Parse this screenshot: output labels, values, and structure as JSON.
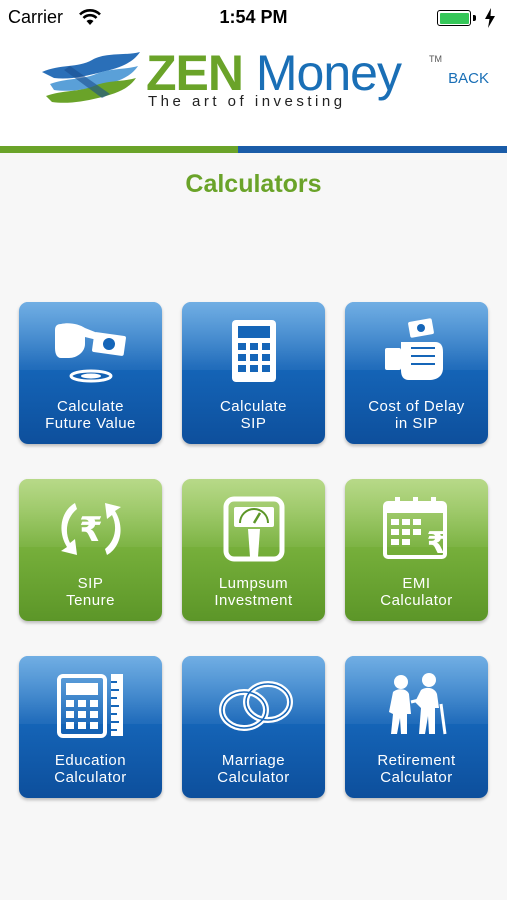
{
  "status_bar": {
    "carrier": "Carrier",
    "time": "1:54 PM"
  },
  "header": {
    "brand_zen": "ZEN",
    "brand_money": "Money",
    "tm": "TM",
    "tagline": "The art of investing",
    "back_label": "BACK",
    "colors": {
      "green": "#6aa329",
      "blue": "#1a6fb6"
    }
  },
  "page_title": "Calculators",
  "tiles": [
    {
      "line1": "Calculate",
      "line2": "Future Value",
      "color": "blue",
      "icon": "hand-money-icon"
    },
    {
      "line1": "Calculate",
      "line2": "SIP",
      "color": "blue",
      "icon": "calculator-icon"
    },
    {
      "line1": "Cost of Delay",
      "line2": "in SIP",
      "color": "blue",
      "icon": "fist-money-icon"
    },
    {
      "line1": "SIP",
      "line2": "Tenure",
      "color": "green",
      "icon": "rupee-cycle-icon"
    },
    {
      "line1": "Lumpsum",
      "line2": "Investment",
      "color": "green",
      "icon": "scale-icon"
    },
    {
      "line1": "EMI",
      "line2": "Calculator",
      "color": "green",
      "icon": "calendar-rupee-icon"
    },
    {
      "line1": "Education",
      "line2": "Calculator",
      "color": "blue",
      "icon": "calculator-ruler-icon"
    },
    {
      "line1": "Marriage",
      "line2": "Calculator",
      "color": "blue",
      "icon": "rings-icon"
    },
    {
      "line1": "Retirement",
      "line2": "Calculator",
      "color": "blue",
      "icon": "elderly-couple-icon"
    }
  ]
}
